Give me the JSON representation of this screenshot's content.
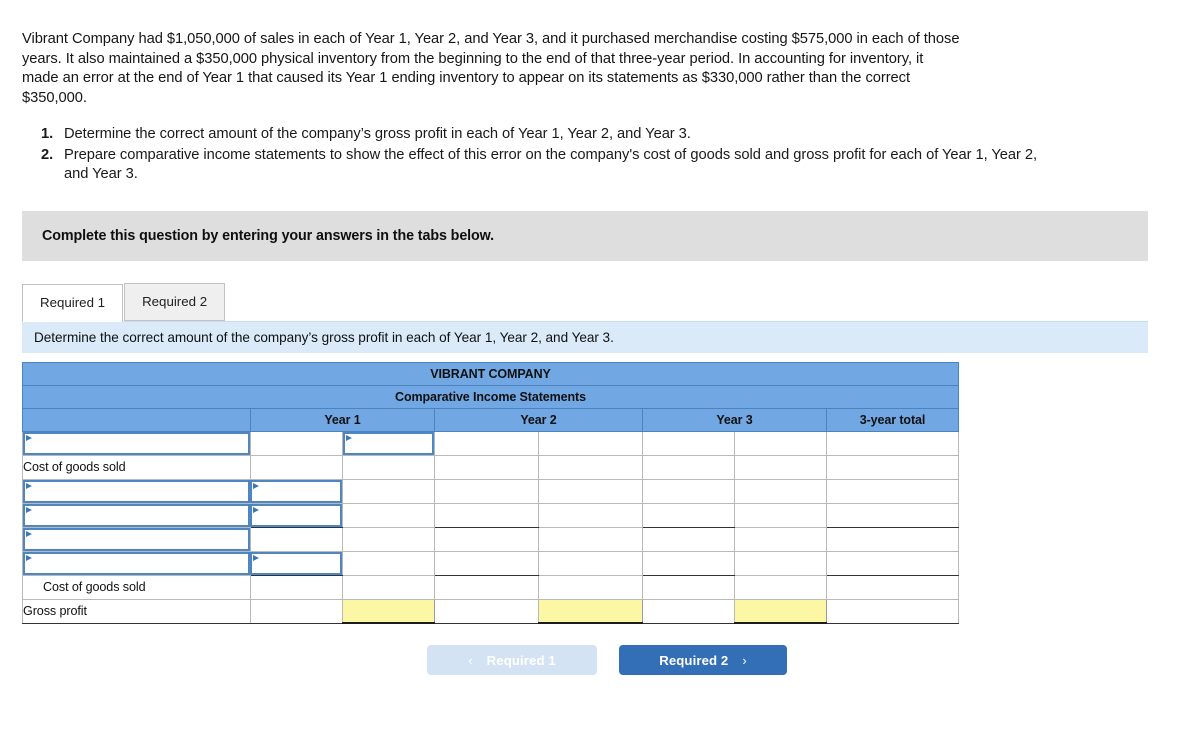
{
  "problem": {
    "statement": "Vibrant Company had $1,050,000 of sales in each of Year 1, Year 2, and Year 3, and it purchased merchandise costing $575,000 in each of those years. It also maintained a $350,000 physical inventory from the beginning to the end of that three-year period. In accounting for inventory, it made an error at the end of Year 1 that caused its Year 1 ending inventory to appear on its statements as $330,000 rather than the correct $350,000.",
    "requirements": [
      {
        "num": "1.",
        "text": "Determine the correct amount of the company’s gross profit in each of Year 1, Year 2, and Year 3."
      },
      {
        "num": "2.",
        "text": "Prepare comparative income statements to show the effect of this error on the company's cost of goods sold and gross profit for each of Year 1, Year 2, and Year 3."
      }
    ]
  },
  "banner": {
    "text": "Complete this question by entering your answers in the tabs below."
  },
  "tabs": [
    {
      "label": "Required 1",
      "active": true
    },
    {
      "label": "Required 2",
      "active": false
    }
  ],
  "prompt": {
    "text": "Determine the correct amount of the company’s gross profit in each of Year 1, Year 2, and Year 3."
  },
  "worksheet": {
    "company_title": "VIBRANT COMPANY",
    "statement_title": "Comparative Income Statements",
    "columns": [
      "",
      "Year 1",
      "Year 2",
      "Year 3",
      "3-year total"
    ],
    "rows": [
      {
        "label": "",
        "type": "input-row-1"
      },
      {
        "label": "Cost of goods sold",
        "type": "plain"
      },
      {
        "label": "",
        "type": "input-row-2"
      },
      {
        "label": "",
        "type": "input-row-2"
      },
      {
        "label": "",
        "type": "input-row-3"
      },
      {
        "label": "",
        "type": "input-row-2"
      },
      {
        "label": "Cost of goods sold",
        "type": "plain-indent"
      },
      {
        "label": "Gross profit",
        "type": "yellow"
      }
    ]
  },
  "footer": {
    "prev_label": "Required 1",
    "prev_chevron": "‹",
    "next_label": "Required 2",
    "next_chevron": "›"
  },
  "colors": {
    "header_blue": "#71a8e4",
    "prompt_blue": "#daeaf8",
    "banner_gray": "#dedede",
    "input_border": "#4d86c0",
    "answer_yellow": "#fbf7a5",
    "next_button": "#336fb7",
    "prev_button": "#d3e3f4"
  }
}
